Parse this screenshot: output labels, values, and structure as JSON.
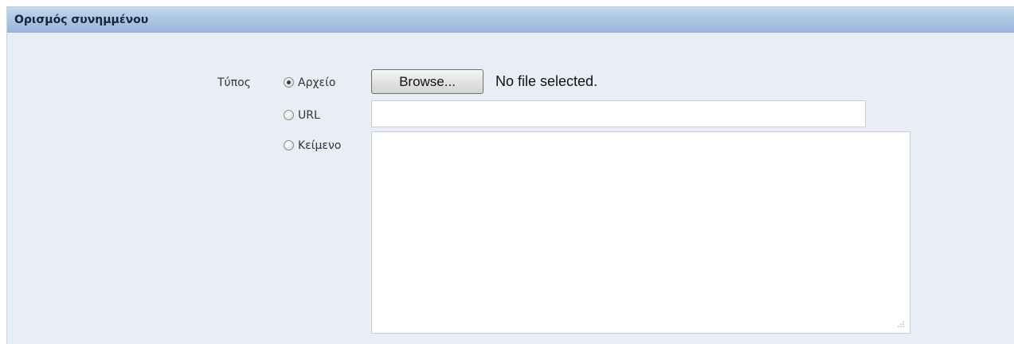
{
  "panel": {
    "title": "Ορισμός συνημμένου"
  },
  "form": {
    "type_label": "Τύπος",
    "options": [
      {
        "label": "Αρχείο",
        "checked": true
      },
      {
        "label": "URL",
        "checked": false
      },
      {
        "label": "Κείμενο",
        "checked": false
      }
    ],
    "file": {
      "browse_label": "Browse...",
      "status": "No file selected."
    },
    "url": {
      "value": ""
    },
    "text": {
      "value": ""
    }
  },
  "colors": {
    "panel_background": "#e9eef6",
    "header_gradient_top": "#c5d8ee",
    "header_gradient_bottom": "#9bb9dd",
    "title_text": "#16253a"
  }
}
